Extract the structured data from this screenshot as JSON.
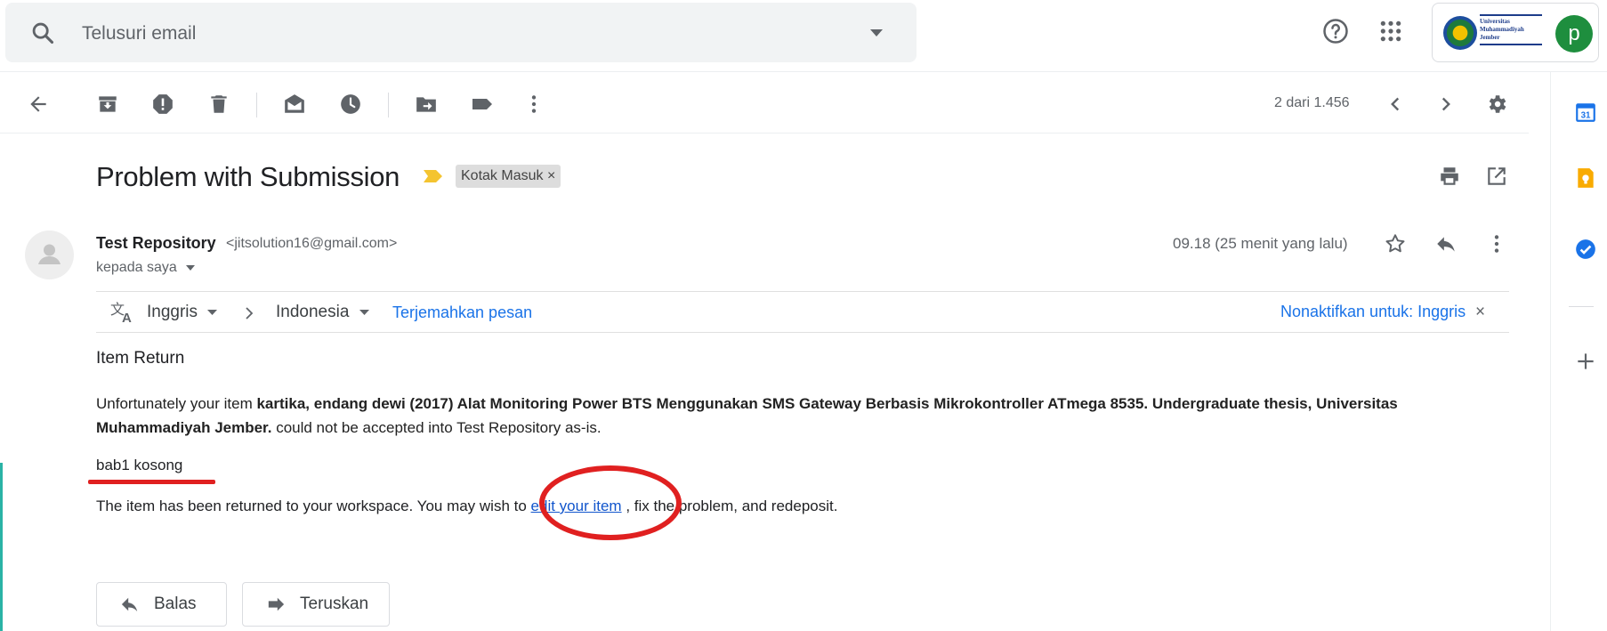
{
  "search": {
    "placeholder": "Telusuri email"
  },
  "account": {
    "logo_line1": "Universitas",
    "logo_line2": "Muhammadiyah",
    "logo_line3": "Jember",
    "avatar_letter": "p"
  },
  "toolbar": {
    "pager": "2 dari 1.456"
  },
  "email": {
    "subject": "Problem with Submission",
    "label": "Kotak Masuk",
    "label_close": "×",
    "sender_name": "Test Repository",
    "sender_email": "<jitsolution16@gmail.com>",
    "to": "kepada saya",
    "timestamp": "09.18 (25 menit yang lalu)"
  },
  "translate": {
    "from_lang": "Inggris",
    "to_lang": "Indonesia",
    "translate_link": "Terjemahkan pesan",
    "disable_link": "Nonaktifkan untuk: Inggris",
    "close": "×"
  },
  "body": {
    "heading": "Item Return",
    "para_prefix": "Unfortunately your item ",
    "item_citation": "kartika, endang dewi (2017) Alat Monitoring Power BTS Menggunakan SMS Gateway Berbasis Mikrokontroller ATmega 8535. Undergraduate thesis, Universitas Muhammadiyah Jember.",
    "para_suffix": " could not be accepted into Test Repository as-is.",
    "reason": "bab1 kosong",
    "returned_prefix": "The item has been returned to your workspace. You may wish to ",
    "edit_link": "edit your item",
    "returned_suffix": " , fix the problem, and redeposit."
  },
  "actions": {
    "reply": "Balas",
    "forward": "Teruskan"
  },
  "side_panel": {
    "calendar_day": "31"
  },
  "colors": {
    "accent_blue": "#1a73e8",
    "annotation_red": "#e02020",
    "avatar_green": "#1e8e3e"
  }
}
